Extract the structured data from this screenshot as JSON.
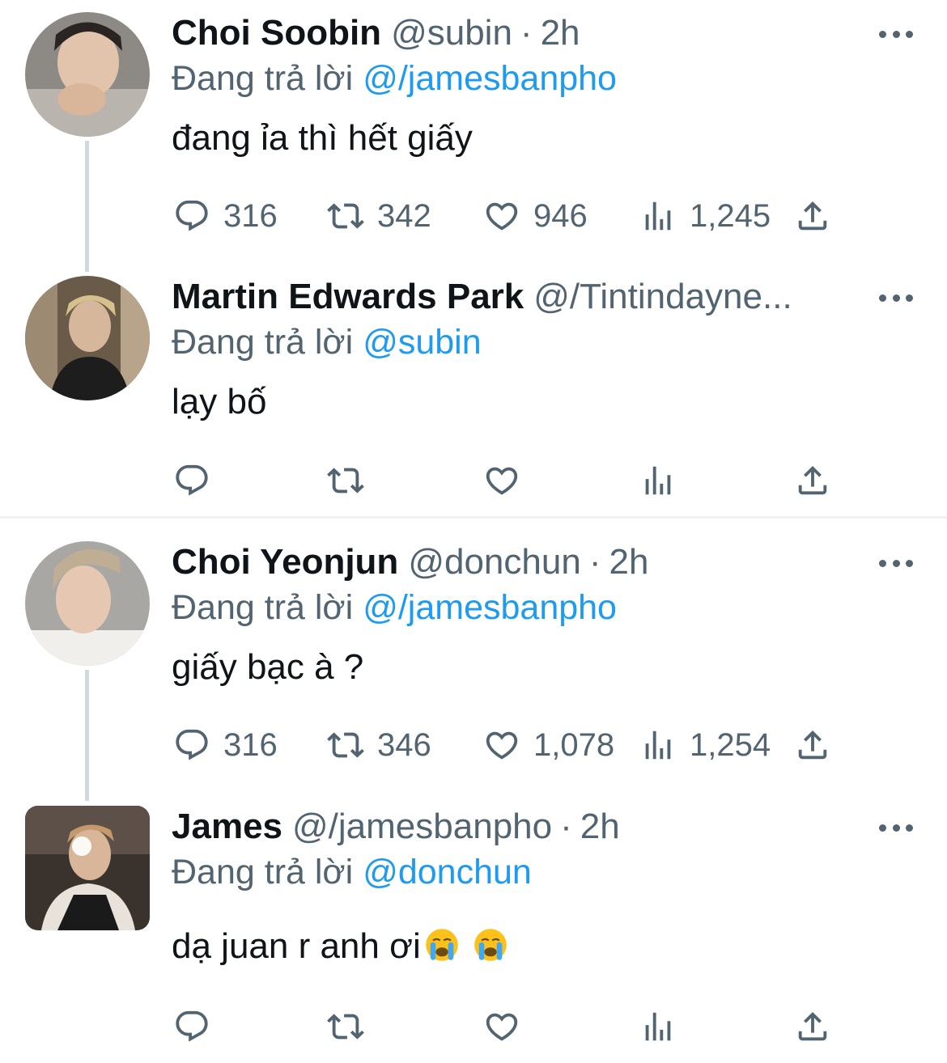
{
  "tweets": [
    {
      "name": "Choi Soobin",
      "handle": "@subin",
      "dot": "·",
      "time": "2h",
      "reply_label": "Đang trả lời",
      "reply_to": "@/jamesbanpho",
      "text": "đang ỉa thì hết giấy",
      "counts": {
        "reply": "316",
        "retweet": "342",
        "like": "946",
        "views": "1,245"
      }
    },
    {
      "name": "Martin Edwards Park",
      "handle": "@/Tintindayne...",
      "reply_label": "Đang trả lời",
      "reply_to": "@subin",
      "text": "lạy bố"
    },
    {
      "name": "Choi Yeonjun",
      "handle": "@donchun",
      "dot": "·",
      "time": "2h",
      "reply_label": "Đang trả lời",
      "reply_to": "@/jamesbanpho",
      "text": "giấy bạc à ?",
      "counts": {
        "reply": "316",
        "retweet": "346",
        "like": "1,078",
        "views": "1,254"
      }
    },
    {
      "name": "James",
      "handle": "@/jamesbanpho",
      "dot": "·",
      "time": "2h",
      "reply_label": "Đang trả lời",
      "reply_to": "@donchun",
      "text": "dạ juan r anh ơi",
      "emojis": [
        "loudly-crying-face-emoji",
        "loudly-crying-face-emoji"
      ]
    }
  ],
  "icons": {
    "reply": "speech-bubble-icon",
    "retweet": "retweet-icon",
    "like": "heart-icon",
    "views": "bar-chart-icon",
    "share": "share-upload-icon",
    "more": "more-dots-icon"
  },
  "colors": {
    "text": "#0f1419",
    "secondary": "#536471",
    "accent": "#1d9bf0",
    "thread_line": "#cfd9de",
    "divider": "#eff3f4"
  }
}
